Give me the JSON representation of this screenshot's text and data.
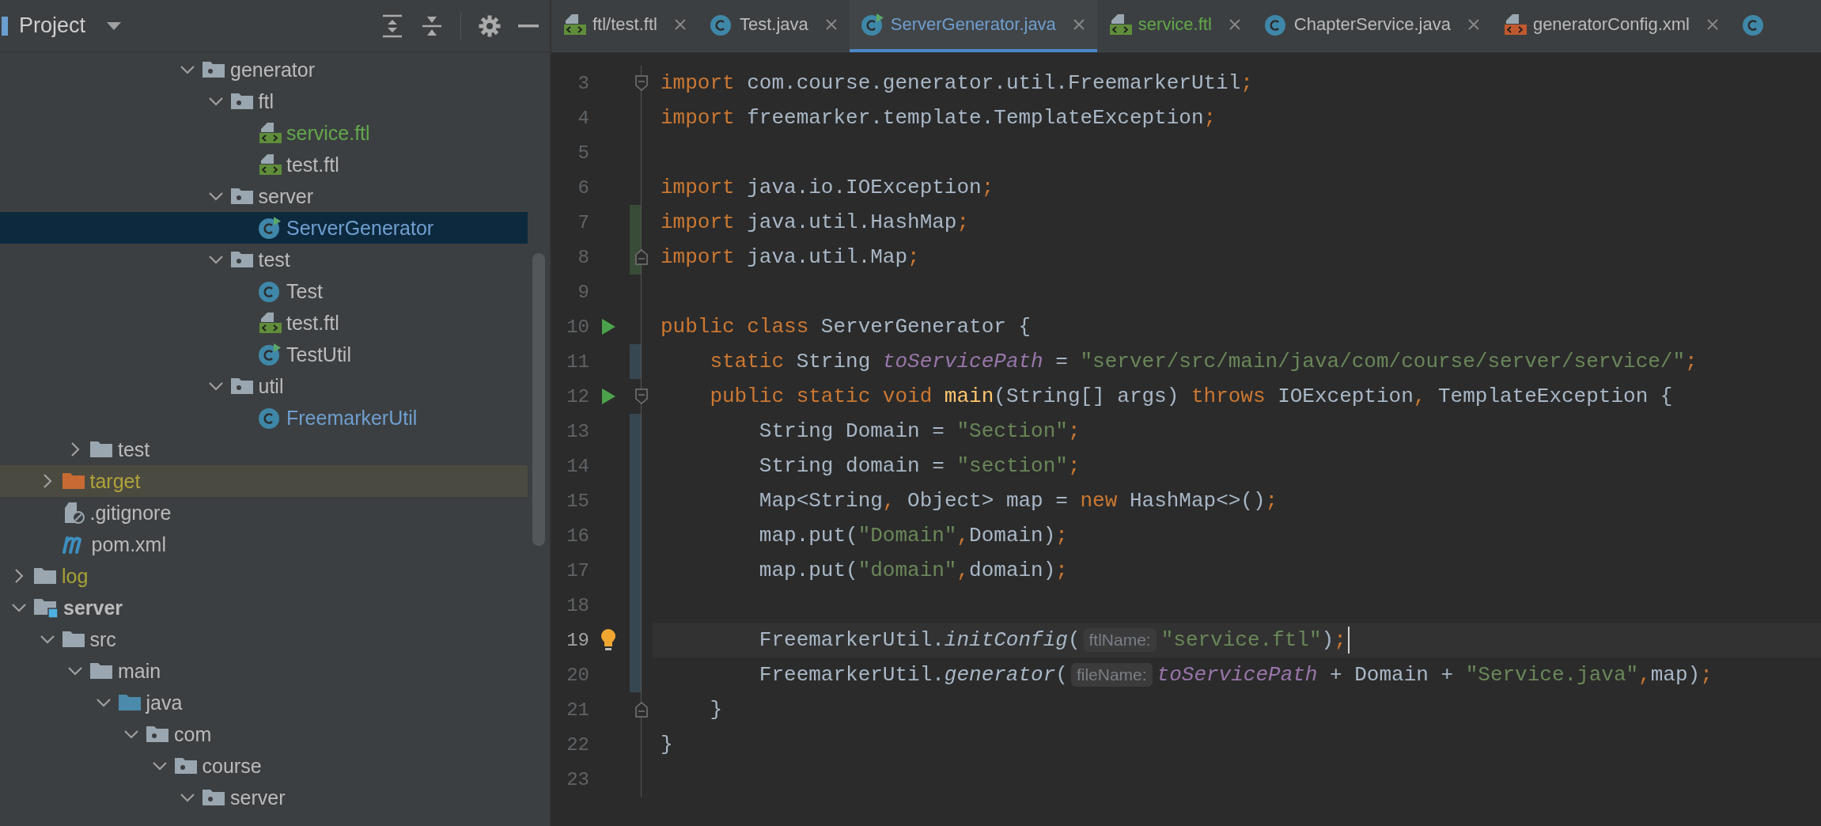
{
  "project_panel": {
    "title": "Project",
    "tree": [
      {
        "children": [
          {
            "children": [
              {
                "children": [
                  {
                    "children": [
                      {
                        "children": [
                          {
                            "children": [
                              {
                                "label": "generator",
                                "kind": "package",
                                "expanded": true,
                                "selected": false,
                                "color": "#bbbbbb",
                                "children": [
                                  {
                                    "label": "ftl",
                                    "kind": "package",
                                    "expanded": true,
                                    "selected": false,
                                    "color": "#bbbbbb",
                                    "children": [
                                      {
                                        "label": "service.ftl",
                                        "kind": "ftl",
                                        "selected": false,
                                        "color": "#62a84a"
                                      },
                                      {
                                        "label": "test.ftl",
                                        "kind": "ftl",
                                        "selected": false,
                                        "color": "#bbbbbb"
                                      }
                                    ]
                                  },
                                  {
                                    "label": "server",
                                    "kind": "package",
                                    "expanded": true,
                                    "selected": false,
                                    "color": "#bbbbbb",
                                    "children": [
                                      {
                                        "label": "ServerGenerator",
                                        "kind": "runnable-class",
                                        "selected": true,
                                        "color": "#6f9fd0"
                                      }
                                    ]
                                  },
                                  {
                                    "label": "test",
                                    "kind": "package",
                                    "expanded": true,
                                    "selected": false,
                                    "color": "#bbbbbb",
                                    "children": [
                                      {
                                        "label": "Test",
                                        "kind": "class",
                                        "selected": false,
                                        "color": "#bbbbbb"
                                      },
                                      {
                                        "label": "test.ftl",
                                        "kind": "ftl",
                                        "selected": false,
                                        "color": "#bbbbbb"
                                      },
                                      {
                                        "label": "TestUtil",
                                        "kind": "runnable-class",
                                        "selected": false,
                                        "color": "#bbbbbb"
                                      }
                                    ]
                                  },
                                  {
                                    "label": "util",
                                    "kind": "package",
                                    "expanded": true,
                                    "selected": false,
                                    "color": "#bbbbbb",
                                    "children": [
                                      {
                                        "label": "FreemarkerUtil",
                                        "kind": "class",
                                        "selected": false,
                                        "color": "#6f9fd0"
                                      }
                                    ]
                                  }
                                ]
                              }
                            ]
                          }
                        ]
                      }
                    ]
                  }
                ]
              },
              {
                "label": "test",
                "kind": "folder",
                "expanded": false,
                "selected": false,
                "color": "#bbbbbb"
              }
            ]
          },
          {
            "label": "target",
            "kind": "excluded-folder",
            "expanded": false,
            "selected": false,
            "color": "#b0a33a"
          },
          {
            "label": ".gitignore",
            "kind": "gitignore",
            "selected": false,
            "color": "#bbbbbb"
          },
          {
            "label": "pom.xml",
            "kind": "maven",
            "selected": false,
            "color": "#bbbbbb"
          }
        ]
      },
      {
        "label": "log",
        "kind": "folder",
        "expanded": false,
        "selected": false,
        "color": "#a8a236"
      },
      {
        "label": "server",
        "kind": "module",
        "expanded": true,
        "selected": false,
        "color": "#bbbbbb",
        "children": [
          {
            "label": "src",
            "kind": "folder",
            "expanded": true,
            "selected": false,
            "color": "#bbbbbb",
            "children": [
              {
                "label": "main",
                "kind": "folder",
                "expanded": true,
                "selected": false,
                "color": "#bbbbbb",
                "children": [
                  {
                    "label": "java",
                    "kind": "source-folder",
                    "expanded": true,
                    "selected": false,
                    "color": "#bbbbbb",
                    "children": [
                      {
                        "label": "com",
                        "kind": "package",
                        "expanded": true,
                        "selected": false,
                        "color": "#bbbbbb",
                        "children": [
                          {
                            "label": "course",
                            "kind": "package",
                            "expanded": true,
                            "selected": false,
                            "color": "#bbbbbb",
                            "children": [
                              {
                                "label": "server",
                                "kind": "package",
                                "expanded": true,
                                "selected": false,
                                "color": "#bbbbbb"
                              }
                            ]
                          }
                        ]
                      }
                    ]
                  }
                ]
              }
            ]
          }
        ]
      }
    ]
  },
  "editor": {
    "tabs": [
      {
        "label": "ftl/test.ftl",
        "kind": "ftl",
        "selected": false,
        "color": "#bbbbbb"
      },
      {
        "label": "Test.java",
        "kind": "class",
        "selected": false,
        "color": "#bbbbbb"
      },
      {
        "label": "ServerGenerator.java",
        "kind": "runnable-class",
        "selected": true,
        "color": "#6f9fd0"
      },
      {
        "label": "service.ftl",
        "kind": "ftl",
        "selected": false,
        "color": "#62a84a"
      },
      {
        "label": "ChapterService.java",
        "kind": "class",
        "selected": false,
        "color": "#bbbbbb"
      },
      {
        "label": "generatorConfig.xml",
        "kind": "xml",
        "selected": false,
        "color": "#bbbbbb"
      },
      {
        "kind": "class",
        "selected": false
      }
    ],
    "lines": [
      {
        "number": "3",
        "run": false,
        "current": false,
        "bulb": false,
        "fold_start": true,
        "tokens": [
          {
            "kind": "keyword",
            "text": "import"
          },
          {
            "kind": "plain",
            "text": " com.course.generator.util.FreemarkerUtil"
          },
          {
            "kind": "punct",
            "text": ";"
          }
        ]
      },
      {
        "number": "4",
        "run": false,
        "current": false,
        "bulb": false,
        "tokens": [
          {
            "kind": "keyword",
            "text": "import"
          },
          {
            "kind": "plain",
            "text": " freemarker.template.TemplateException"
          },
          {
            "kind": "punct",
            "text": ";"
          }
        ]
      },
      {
        "number": "5",
        "run": false,
        "current": false,
        "bulb": false
      },
      {
        "number": "6",
        "run": false,
        "current": false,
        "bulb": false,
        "tokens": [
          {
            "kind": "keyword",
            "text": "import"
          },
          {
            "kind": "plain",
            "text": " java.io.IOException"
          },
          {
            "kind": "punct",
            "text": ";"
          }
        ]
      },
      {
        "number": "7",
        "run": false,
        "current": false,
        "bulb": false,
        "added": true,
        "tokens": [
          {
            "kind": "keyword",
            "text": "import"
          },
          {
            "kind": "plain",
            "text": " java.util.HashMap"
          },
          {
            "kind": "punct",
            "text": ";"
          }
        ]
      },
      {
        "number": "8",
        "run": false,
        "current": false,
        "bulb": false,
        "added": true,
        "fold_end": true,
        "tokens": [
          {
            "kind": "keyword",
            "text": "import"
          },
          {
            "kind": "plain",
            "text": " java.util.Map"
          },
          {
            "kind": "punct",
            "text": ";"
          }
        ]
      },
      {
        "number": "9",
        "run": false,
        "current": false,
        "bulb": false
      },
      {
        "number": "10",
        "run": true,
        "current": false,
        "bulb": false,
        "tokens": [
          {
            "kind": "keyword",
            "text": "public class"
          },
          {
            "kind": "plain",
            "text": " ServerGenerator {"
          }
        ]
      },
      {
        "number": "11",
        "run": false,
        "current": false,
        "bulb": false,
        "modified": true,
        "tokens": [
          {
            "kind": "keyword",
            "text": "    static"
          },
          {
            "kind": "plain",
            "text": " String "
          },
          {
            "kind": "field",
            "text": "toServicePath"
          },
          {
            "kind": "plain",
            "text": " = "
          },
          {
            "kind": "string",
            "text": "\"server/src/main/java/com/course/server/service/\""
          },
          {
            "kind": "punct",
            "text": ";"
          }
        ]
      },
      {
        "number": "12",
        "run": true,
        "current": false,
        "bulb": false,
        "fold_start": true,
        "tokens": [
          {
            "kind": "keyword",
            "text": "    public static void "
          },
          {
            "kind": "method",
            "text": "main"
          },
          {
            "kind": "plain",
            "text": "(String[] args) "
          },
          {
            "kind": "keyword",
            "text": "throws"
          },
          {
            "kind": "plain",
            "text": " IOException"
          },
          {
            "kind": "punct",
            "text": ","
          },
          {
            "kind": "plain",
            "text": " TemplateException {"
          }
        ]
      },
      {
        "number": "13",
        "run": false,
        "current": false,
        "bulb": false,
        "modified": true,
        "tokens": [
          {
            "kind": "plain",
            "text": "        String Domain = "
          },
          {
            "kind": "string",
            "text": "\"Section\""
          },
          {
            "kind": "punct",
            "text": ";"
          }
        ]
      },
      {
        "number": "14",
        "run": false,
        "current": false,
        "bulb": false,
        "modified": true,
        "tokens": [
          {
            "kind": "plain",
            "text": "        String domain = "
          },
          {
            "kind": "string",
            "text": "\"section\""
          },
          {
            "kind": "punct",
            "text": ";"
          }
        ]
      },
      {
        "number": "15",
        "run": false,
        "current": false,
        "bulb": false,
        "modified": true,
        "tokens": [
          {
            "kind": "plain",
            "text": "        Map<String"
          },
          {
            "kind": "punct",
            "text": ","
          },
          {
            "kind": "plain",
            "text": " Object> map = "
          },
          {
            "kind": "keyword",
            "text": "new"
          },
          {
            "kind": "plain",
            "text": " HashMap<>()"
          },
          {
            "kind": "punct",
            "text": ";"
          }
        ]
      },
      {
        "number": "16",
        "run": false,
        "current": false,
        "bulb": false,
        "modified": true,
        "tokens": [
          {
            "kind": "plain",
            "text": "        map.put("
          },
          {
            "kind": "string",
            "text": "\"Domain\""
          },
          {
            "kind": "punct",
            "text": ","
          },
          {
            "kind": "plain",
            "text": "Domain)"
          },
          {
            "kind": "punct",
            "text": ";"
          }
        ]
      },
      {
        "number": "17",
        "run": false,
        "current": false,
        "bulb": false,
        "modified": true,
        "tokens": [
          {
            "kind": "plain",
            "text": "        map.put("
          },
          {
            "kind": "string",
            "text": "\"domain\""
          },
          {
            "kind": "punct",
            "text": ","
          },
          {
            "kind": "plain",
            "text": "domain)"
          },
          {
            "kind": "punct",
            "text": ";"
          }
        ]
      },
      {
        "number": "18",
        "run": false,
        "current": false,
        "bulb": false,
        "modified": true
      },
      {
        "number": "19",
        "run": false,
        "current": true,
        "bulb": true,
        "modified": true,
        "tokens": [
          {
            "kind": "plain",
            "text": "        FreemarkerUtil."
          },
          {
            "kind": "call",
            "text": "initConfig"
          },
          {
            "kind": "plain",
            "text": "("
          },
          {
            "kind": "hint",
            "text": "ftlName:"
          },
          {
            "kind": "string",
            "text": "\"service.ftl\""
          },
          {
            "kind": "plain",
            "text": ")"
          },
          {
            "kind": "punct",
            "text": ";"
          }
        ]
      },
      {
        "number": "20",
        "run": false,
        "current": false,
        "bulb": false,
        "modified": true,
        "tokens": [
          {
            "kind": "plain",
            "text": "        FreemarkerUtil."
          },
          {
            "kind": "call",
            "text": "generator"
          },
          {
            "kind": "plain",
            "text": "("
          },
          {
            "kind": "hint",
            "text": "fileName:"
          },
          {
            "kind": "field",
            "text": "toServicePath"
          },
          {
            "kind": "plain",
            "text": " + Domain + "
          },
          {
            "kind": "string",
            "text": "\"Service.java\""
          },
          {
            "kind": "punct",
            "text": ","
          },
          {
            "kind": "plain",
            "text": "map)"
          },
          {
            "kind": "punct",
            "text": ";"
          }
        ]
      },
      {
        "number": "21",
        "run": false,
        "current": false,
        "bulb": false,
        "fold_end": true,
        "tokens": [
          {
            "kind": "plain",
            "text": "    }"
          }
        ]
      },
      {
        "number": "22",
        "run": false,
        "current": false,
        "bulb": false,
        "tokens": [
          {
            "kind": "plain",
            "text": "}"
          }
        ]
      },
      {
        "number": "23",
        "run": false,
        "current": false,
        "bulb": false
      }
    ]
  }
}
